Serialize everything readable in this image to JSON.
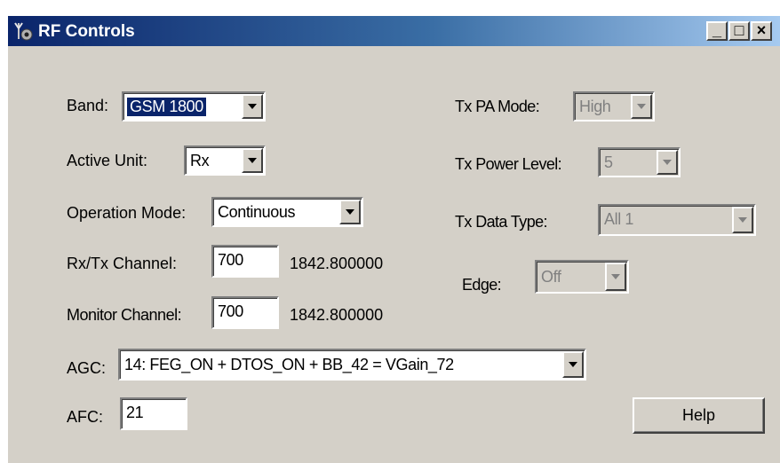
{
  "window": {
    "title": "RF Controls",
    "app_icon": "antenna-icon"
  },
  "titlebar_buttons": {
    "minimize": "_",
    "maximize": "□",
    "close": "×"
  },
  "band": {
    "label": "Band:",
    "value": "GSM 1800"
  },
  "active_unit": {
    "label": "Active Unit:",
    "value": "Rx"
  },
  "operation_mode": {
    "label": "Operation Mode:",
    "value": "Continuous"
  },
  "rxtx_channel": {
    "label": "Rx/Tx Channel:",
    "value": "700",
    "frequency": "1842.800000"
  },
  "monitor_channel": {
    "label": "Monitor Channel:",
    "value": "700",
    "frequency": "1842.800000"
  },
  "agc": {
    "label": "AGC:",
    "value": "14: FEG_ON + DTOS_ON + BB_42 = VGain_72"
  },
  "afc": {
    "label": "AFC:",
    "value": "21"
  },
  "tx_pa_mode": {
    "label": "Tx PA Mode:",
    "value": "High"
  },
  "tx_power_level": {
    "label": "Tx Power Level:",
    "value": "5"
  },
  "tx_data_type": {
    "label": "Tx Data Type:",
    "value": "All 1"
  },
  "edge": {
    "label": "Edge:",
    "value": "Off"
  },
  "help_button": {
    "label": "Help"
  }
}
